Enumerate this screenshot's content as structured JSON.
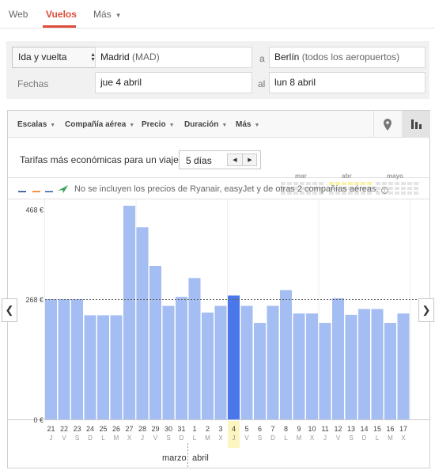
{
  "tabs": {
    "web": "Web",
    "vuelos": "Vuelos",
    "mas": "Más"
  },
  "form": {
    "trip_type": "Ida y vuelta",
    "origin_city": "Madrid",
    "origin_code": "(MAD)",
    "to_label": "a",
    "destination_city": "Berlín",
    "destination_extra": "(todos los aeropuertos)",
    "dates_label": "Fechas",
    "depart_date": "jue 4 abril",
    "dates_to_label": "al",
    "return_date": "lun 8 abril"
  },
  "filters": [
    "Escalas",
    "Compañía aérea",
    "Precio",
    "Duración",
    "Más"
  ],
  "icons": {
    "map": "map-pin-icon",
    "bars": "bar-chart-icon"
  },
  "fares": {
    "label": "Tarifas más económicas para un viaje de",
    "duration_value": "5 días",
    "mini_months": [
      "mar",
      "abr",
      "mayo"
    ]
  },
  "notice": {
    "text": "No se incluyen los precios de Ryanair, easyJet y de otras 2 compañías aéreas.",
    "logos": [
      "ryanair",
      "easyjet",
      "airline-3",
      "airline-4"
    ]
  },
  "chart_data": {
    "type": "bar",
    "y_tick_labels": [
      "468 €",
      "268 €",
      "0 €"
    ],
    "y_ticks": [
      468,
      268,
      0
    ],
    "ylim": [
      0,
      510
    ],
    "reference_line": 268,
    "selected_index": 14,
    "categories": [
      "21",
      "22",
      "23",
      "24",
      "25",
      "26",
      "27",
      "28",
      "29",
      "30",
      "31",
      "1",
      "2",
      "3",
      "4",
      "5",
      "6",
      "7",
      "8",
      "9",
      "10",
      "11",
      "12",
      "13",
      "14",
      "15",
      "16",
      "17"
    ],
    "weekdays": [
      "J",
      "V",
      "S",
      "D",
      "L",
      "M",
      "X",
      "J",
      "V",
      "S",
      "D",
      "L",
      "M",
      "X",
      "J",
      "V",
      "S",
      "D",
      "L",
      "M",
      "X",
      "J",
      "V",
      "S",
      "D",
      "L",
      "M",
      "X"
    ],
    "values": [
      268,
      268,
      268,
      232,
      232,
      232,
      476,
      428,
      342,
      253,
      273,
      315,
      238,
      253,
      276,
      253,
      215,
      253,
      288,
      236,
      236,
      215,
      270,
      233,
      246,
      246,
      215,
      236
    ],
    "bar_color": "#a4bdf2",
    "selected_color": "#4a78ea",
    "selected_day_bg": "#fdf5c1",
    "month_labels": [
      "marzo",
      "abril"
    ]
  }
}
